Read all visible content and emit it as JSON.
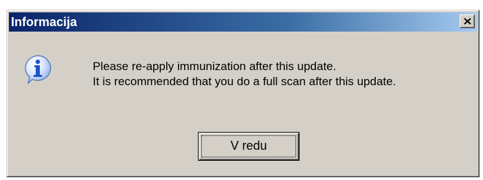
{
  "window": {
    "title": "Informacija",
    "close_glyph": "×"
  },
  "message": {
    "icon": "info-icon",
    "line1": "Please re-apply immunization after this update.",
    "line2": "It is recommended that you do a full scan after this update."
  },
  "buttons": {
    "ok_label": "V redu"
  },
  "colors": {
    "titlebar_start": "#0a246a",
    "titlebar_end": "#a6caf0",
    "dialog_face": "#d4d0c8",
    "icon_blue": "#1f52c8"
  }
}
